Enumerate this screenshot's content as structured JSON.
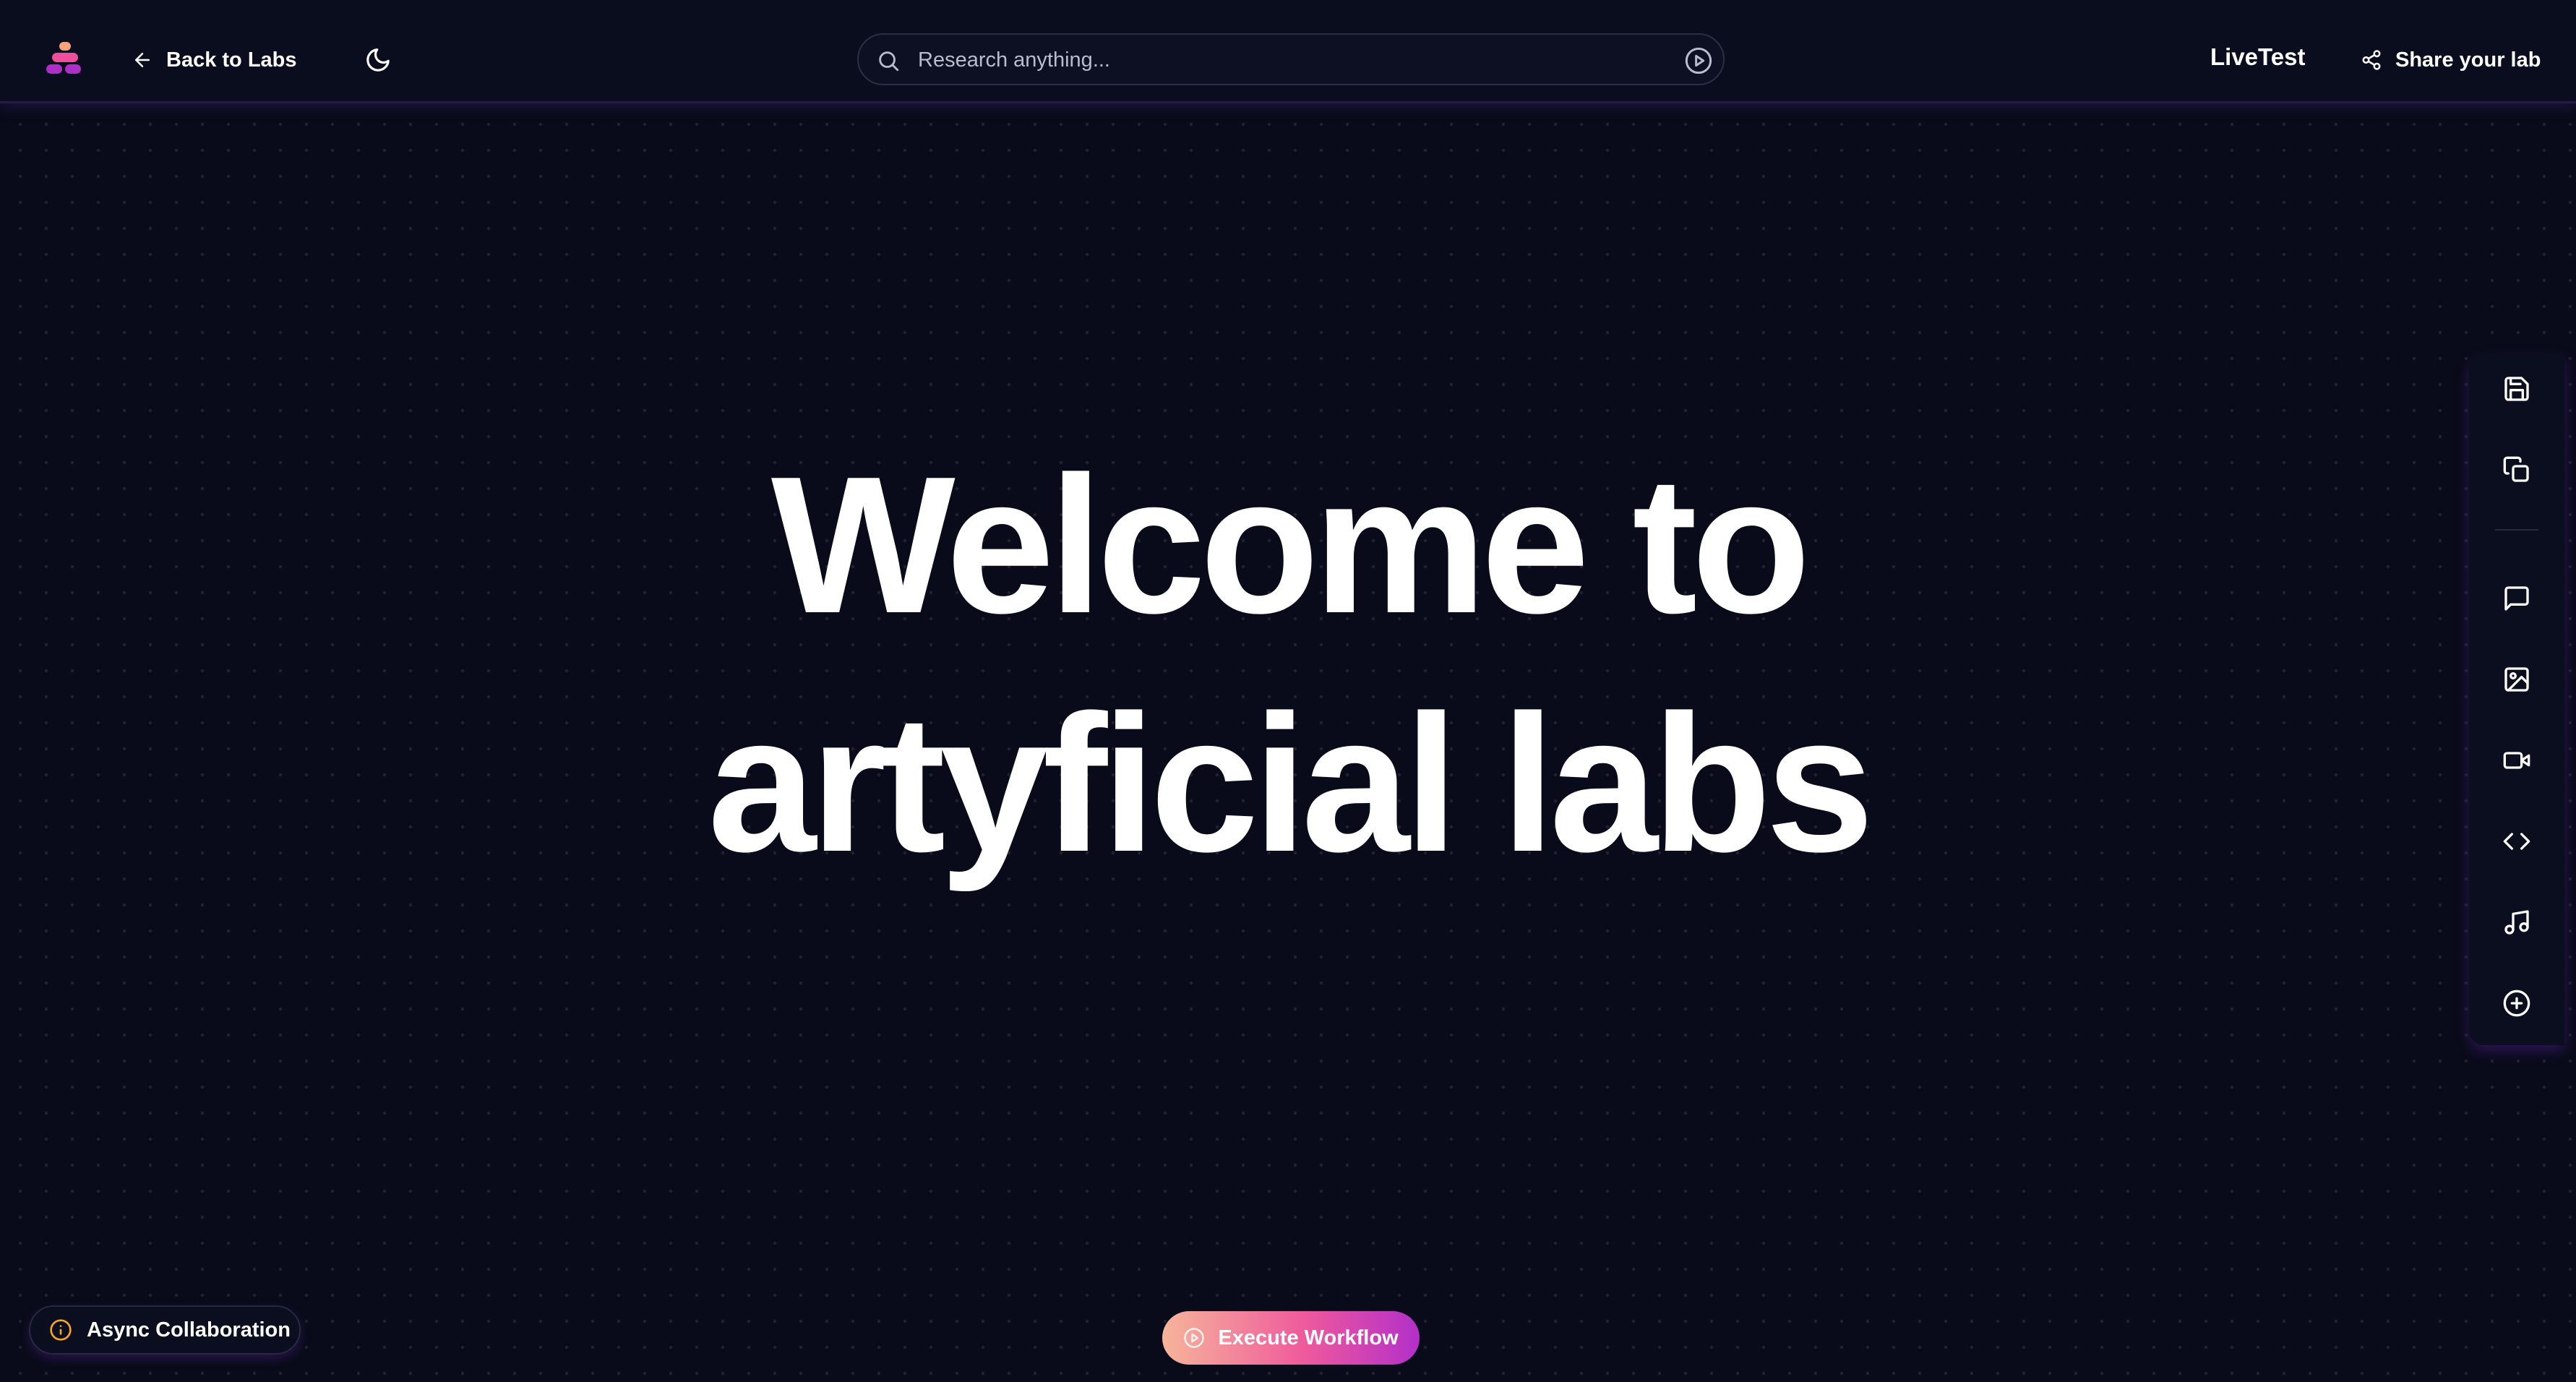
{
  "header": {
    "back_label": "Back to Labs",
    "search_placeholder": "Research anything...",
    "lab_name": "LiveTest",
    "share_label": "Share your lab"
  },
  "hero": {
    "line1": "Welcome to",
    "line2": "artyficial labs"
  },
  "toolbar": {
    "items": [
      {
        "icon": "save-icon"
      },
      {
        "icon": "duplicate-icon"
      },
      {
        "icon": "comment-icon"
      },
      {
        "icon": "image-icon"
      },
      {
        "icon": "video-icon"
      },
      {
        "icon": "code-icon"
      },
      {
        "icon": "music-icon"
      },
      {
        "icon": "add-circle-icon"
      }
    ]
  },
  "footer": {
    "async_label": "Async Collaboration",
    "execute_label": "Execute Workflow"
  },
  "colors": {
    "background": "#090b1a",
    "accent_pink": "#ef5a9c",
    "accent_purple": "#b22fc9",
    "accent_peach": "#f6b59a",
    "info_orange": "#f5a524"
  }
}
